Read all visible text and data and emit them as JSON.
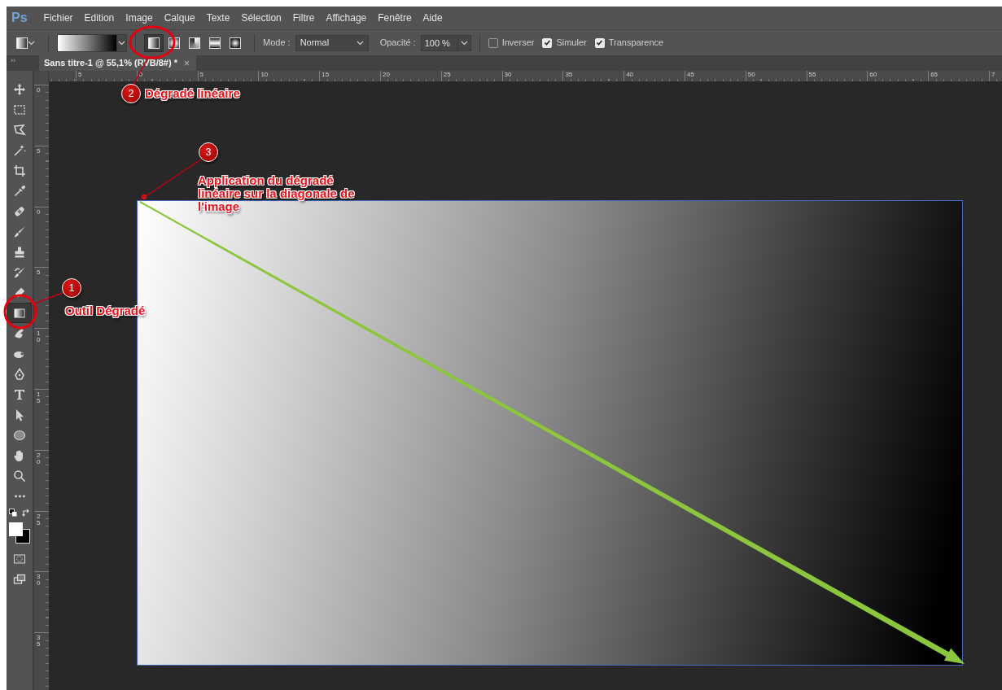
{
  "app": {
    "logo": "Ps"
  },
  "menu": [
    "Fichier",
    "Edition",
    "Image",
    "Calque",
    "Texte",
    "Sélection",
    "Filtre",
    "Affichage",
    "Fenêtre",
    "Aide"
  ],
  "options_bar": {
    "gradient_types": [
      {
        "selected": true
      },
      {
        "selected": false
      },
      {
        "selected": false
      },
      {
        "selected": false
      },
      {
        "selected": false
      }
    ],
    "mode_label": "Mode :",
    "mode_value": "Normal",
    "opacity_label": "Opacité :",
    "opacity_value": "100 %",
    "checkboxes": [
      {
        "label": "Inverser",
        "checked": false
      },
      {
        "label": "Simuler",
        "checked": true
      },
      {
        "label": "Transparence",
        "checked": true
      }
    ]
  },
  "panel_toggle": "››",
  "document_tab": {
    "title": "Sans titre-1 @ 55,1% (RVB/8#) *",
    "close": "×"
  },
  "rulers": {
    "horizontal": [
      "5",
      "0",
      "5",
      "10",
      "15",
      "20",
      "25",
      "30",
      "35",
      "40",
      "45",
      "50",
      "55",
      "60",
      "65",
      "7"
    ],
    "vertical": [
      "0",
      "5",
      "0",
      "5",
      "10",
      "15",
      "20",
      "25",
      "30",
      "35"
    ]
  },
  "tools": [
    {
      "selected": false
    },
    {
      "selected": false
    },
    {
      "selected": false
    },
    {
      "selected": false
    },
    {
      "selected": false
    },
    {
      "selected": false
    },
    {
      "selected": false
    },
    {
      "selected": false
    },
    {
      "selected": false
    },
    {
      "selected": false
    },
    {
      "selected": false
    },
    {
      "selected": true
    },
    {
      "selected": false
    },
    {
      "selected": false
    },
    {
      "selected": false
    },
    {
      "selected": false
    },
    {
      "selected": false
    },
    {
      "selected": false
    },
    {
      "selected": false
    },
    {
      "selected": false
    },
    {
      "selected": false
    }
  ],
  "annotations": [
    {
      "number": "1",
      "text": "Outil Dégradé"
    },
    {
      "number": "2",
      "text": "Dégradé linéaire"
    },
    {
      "number": "3",
      "text": "Application du dégradé linéaire sur la diagonale de l'image"
    }
  ]
}
